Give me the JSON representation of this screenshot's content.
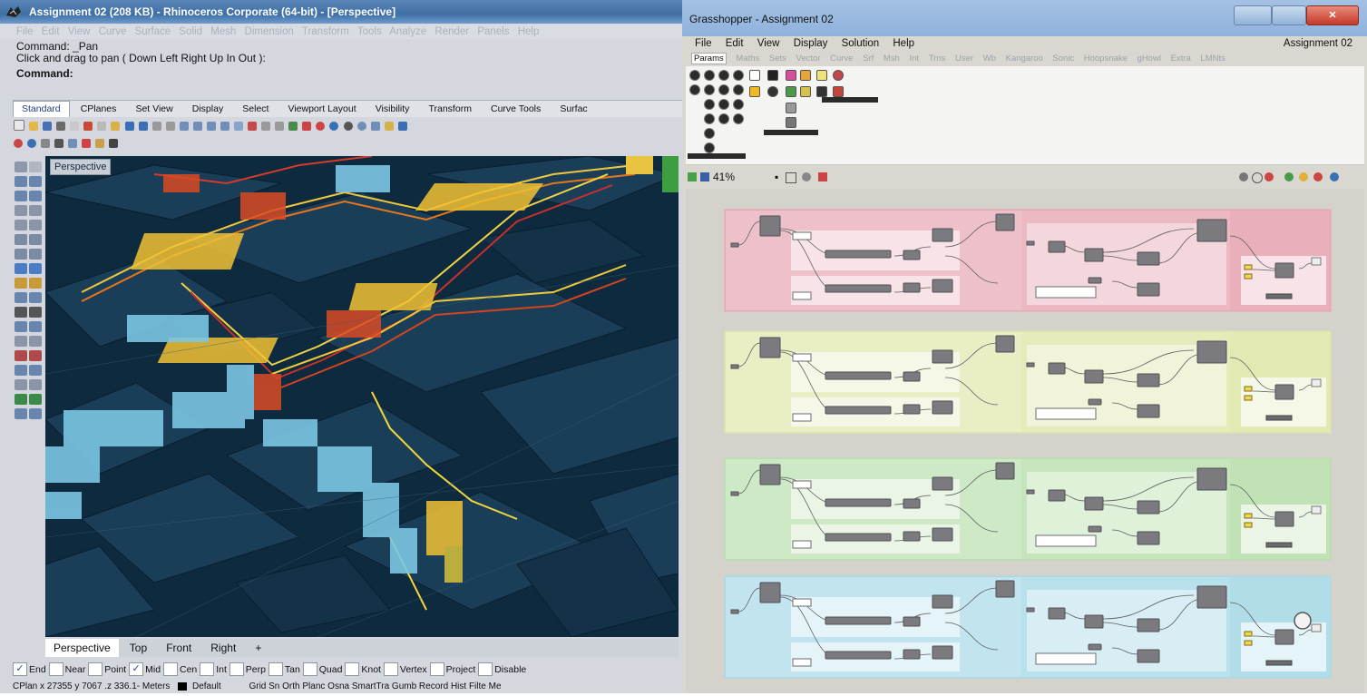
{
  "rhino": {
    "title": "Assignment 02 (208 KB) - Rhinoceros Corporate (64-bit) - [Perspective]",
    "menu": [
      "File",
      "Edit",
      "View",
      "Curve",
      "Surface",
      "Solid",
      "Mesh",
      "Dimension",
      "Transform",
      "Tools",
      "Analyze",
      "Render",
      "Panels",
      "Help"
    ],
    "command_lines": [
      "Command: _Pan",
      "Click and drag to pan ( Down  Left  Right  Up  In  Out ):",
      "Command:"
    ],
    "toolbar_tabs": [
      "Standard",
      "CPlanes",
      "Set View",
      "Display",
      "Select",
      "Viewport Layout",
      "Visibility",
      "Transform",
      "Curve Tools",
      "Surfac"
    ],
    "viewport_label": "Perspective",
    "viewport_tabs": [
      "Perspective",
      "Top",
      "Front",
      "Right",
      "+"
    ],
    "osnaps": [
      {
        "label": "End",
        "checked": true
      },
      {
        "label": "Near",
        "checked": false
      },
      {
        "label": "Point",
        "checked": false
      },
      {
        "label": "Mid",
        "checked": true
      },
      {
        "label": "Cen",
        "checked": false
      },
      {
        "label": "Int",
        "checked": false
      },
      {
        "label": "Perp",
        "checked": false
      },
      {
        "label": "Tan",
        "checked": false
      },
      {
        "label": "Quad",
        "checked": false
      },
      {
        "label": "Knot",
        "checked": false
      },
      {
        "label": "Vertex",
        "checked": false
      },
      {
        "label": "Project",
        "checked": false
      },
      {
        "label": "Disable",
        "checked": false
      }
    ],
    "status": {
      "coords": "CPlan x 27355 y 7067 .z 336.1- Meters",
      "layer": "Default",
      "flags": "Grid Sn Orth Planc Osna SmartTra Gumb Record Hist Filte Me"
    }
  },
  "gh": {
    "title": "Grasshopper - Assignment 02",
    "menu": [
      "File",
      "Edit",
      "View",
      "Display",
      "Solution",
      "Help"
    ],
    "doc_name": "Assignment 02",
    "tabs": [
      "Params",
      "Maths",
      "Sets",
      "Vector",
      "Curve",
      "Srf",
      "Msh",
      "Int",
      "Trns",
      "User",
      "Wb",
      "Kangaroo",
      "Sonic",
      "Hoopsnake",
      "gHowl",
      "Extra",
      "LMNts"
    ],
    "zoom": "41%",
    "group_colors": [
      "#e7a6b3",
      "#dfe6aa",
      "#b9dfac",
      "#a8d9e6"
    ]
  }
}
